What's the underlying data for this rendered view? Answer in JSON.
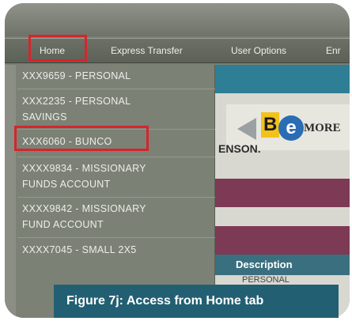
{
  "nav": {
    "items": [
      "Home",
      "Express Transfer",
      "User Options",
      "Enr"
    ]
  },
  "dropdown": {
    "accounts": [
      {
        "line1": "XXX9659 - PERSONAL",
        "line2": ""
      },
      {
        "line1": "XXX2235 - PERSONAL",
        "line2": "SAVINGS"
      },
      {
        "line1": "XXX6060 - BUNCO",
        "line2": ""
      },
      {
        "line1": "XXXX9834 - MISSIONARY",
        "line2": "FUNDS ACCOUNT"
      },
      {
        "line1": "XXXX9842 - MISSIONARY",
        "line2": "FUND ACCOUNT"
      },
      {
        "line1": "XXXX7045 - SMALL 2X5",
        "line2": ""
      }
    ]
  },
  "content": {
    "banner_more": "MORE",
    "name_fragment": "ENSON.",
    "logo_b": "B",
    "logo_e": "e",
    "table_header": "Description",
    "table_first_cell": "PERSONAL"
  },
  "caption": "Figure 7j: Access from Home tab",
  "colors": {
    "highlight": "#d6252b",
    "caption_bg": "#225f73",
    "navbar": "#60655b",
    "dropdown_bg": "#7c8176"
  }
}
